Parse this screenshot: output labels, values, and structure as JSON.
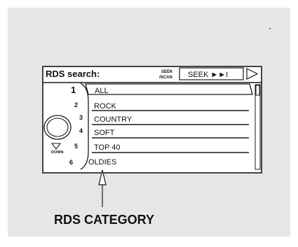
{
  "panel": {
    "title": "RDS search:",
    "seek_scan_top": "SEEK",
    "seek_scan_bottom": "/SCAN",
    "seek_button_label": "SEEK ►►I"
  },
  "list": {
    "items": [
      {
        "number": "1",
        "label": "ALL"
      },
      {
        "number": "2",
        "label": "ROCK"
      },
      {
        "number": "3",
        "label": "COUNTRY"
      },
      {
        "number": "4",
        "label": "SOFT"
      },
      {
        "number": "5",
        "label": "TOP 40"
      },
      {
        "number": "6",
        "label": "OLDIES"
      }
    ],
    "selected_index": 0
  },
  "knob": {
    "down_label": "DOWN"
  },
  "callout": {
    "label": "RDS CATEGORY"
  },
  "colors": {
    "background": "#e6e6e6",
    "line": "#1a1a1a",
    "panel_fill": "#ffffff"
  }
}
